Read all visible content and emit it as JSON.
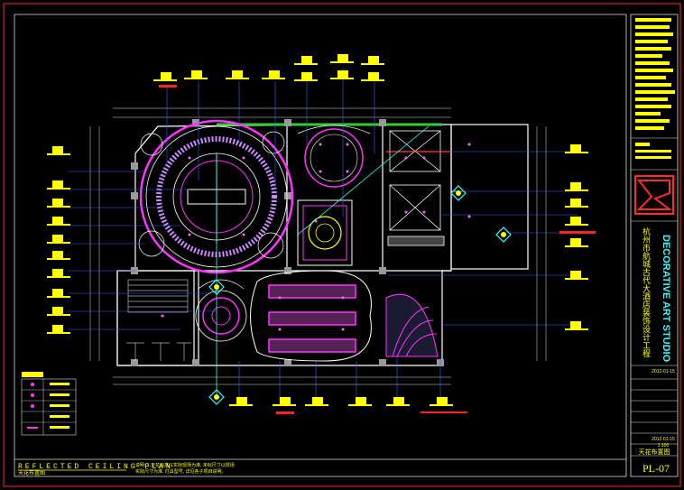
{
  "drawing": {
    "title": "REFLECTED CEILING PLAN",
    "subtitle": "天花布置图",
    "sheet_no": "PL-07",
    "studio_name": "DECORATIVE ART STUDIO",
    "project_name": "杭州市航城古代大酒店装饰设计工程",
    "date_1": "2012-01-15",
    "date_2": "2012-01-15",
    "scale": "1:100",
    "sheet_name": "天花布置图",
    "notes_line1": "说明: 1.天花标高以实际现场为准, 未标尺寸以现场",
    "notes_line2": "实际尺寸为准, 灯具型号, 详见各子项目说明。"
  },
  "colors": {
    "background": "#000000",
    "frame": "#ff2a2a",
    "wall": "#ffffff",
    "magenta": "#ff33ff",
    "cyan": "#33ffff",
    "yellow": "#ffff00",
    "green": "#33cc33",
    "blue": "#3366ff",
    "red": "#ff2222"
  },
  "icons": [
    "drawing-logo-icon",
    "ceiling-light-icon",
    "downlight-icon",
    "spotlight-icon"
  ]
}
